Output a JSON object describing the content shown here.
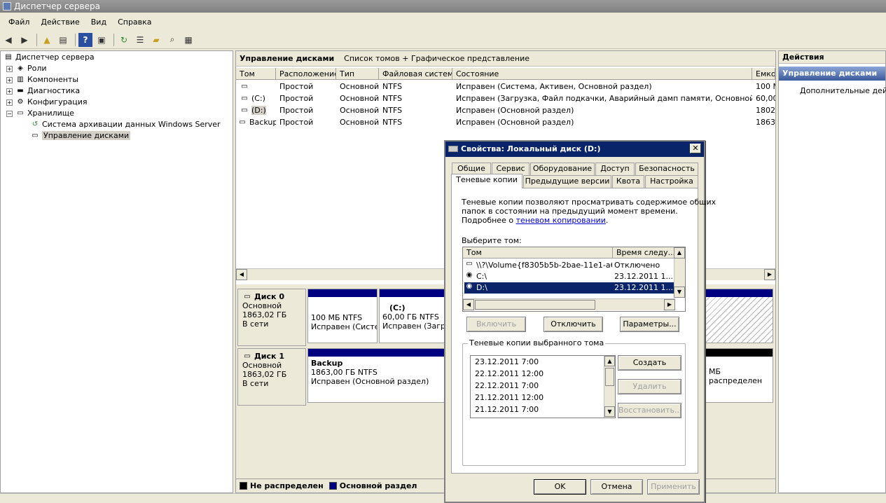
{
  "window": {
    "title": "Диспетчер сервера"
  },
  "menu": [
    "Файл",
    "Действие",
    "Вид",
    "Справка"
  ],
  "tree": {
    "root": "Диспетчер сервера",
    "items": [
      "Роли",
      "Компоненты",
      "Диагностика",
      "Конфигурация",
      "Хранилище"
    ],
    "storage_children": [
      "Система архивации данных Windows Server",
      "Управление дисками"
    ]
  },
  "center": {
    "title": "Управление дисками",
    "subtitle": "Список томов + Графическое представление",
    "columns": [
      "Том",
      "Расположение",
      "Тип",
      "Файловая система",
      "Состояние",
      "Емкос"
    ],
    "rows": [
      {
        "vol": "",
        "loc": "Простой",
        "type": "Основной",
        "fs": "NTFS",
        "state": "Исправен (Система, Активен, Основной раздел)",
        "cap": "100 М"
      },
      {
        "vol": "(C:)",
        "loc": "Простой",
        "type": "Основной",
        "fs": "NTFS",
        "state": "Исправен (Загрузка, Файл подкачки, Аварийный дамп памяти, Основной раздел)",
        "cap": "60,00"
      },
      {
        "vol": "(D:)",
        "loc": "Простой",
        "type": "Основной",
        "fs": "NTFS",
        "state": "Исправен (Основной раздел)",
        "cap": "1802"
      },
      {
        "vol": "Backup",
        "loc": "Простой",
        "type": "Основной",
        "fs": "NTFS",
        "state": "Исправен (Основной раздел)",
        "cap": "1863"
      }
    ]
  },
  "disks": [
    {
      "name": "Диск 0",
      "kind": "Основной",
      "size": "1863,02 ГБ",
      "status": "В сети",
      "p1_size": "100 МБ NTFS",
      "p1_state": "Исправен (Систе",
      "p2_name": "(C:)",
      "p2_size": "60,00 ГБ NTFS",
      "p2_state": "Исправен (Загруз"
    },
    {
      "name": "Диск 1",
      "kind": "Основной",
      "size": "1863,02 ГБ",
      "status": "В сети",
      "p1_name": "Backup",
      "p1_size": "1863,00 ГБ NTFS",
      "p1_state": "Исправен (Основной раздел)",
      "p2_size": "МБ",
      "p2_state": "распределен"
    }
  ],
  "legend": [
    "Не распределен",
    "Основной раздел"
  ],
  "legend_colors": {
    "unallocated": "#000000",
    "primary": "#000080"
  },
  "actions": {
    "title": "Действия",
    "selected": "Управление дисками",
    "item": "Дополнительные дейст"
  },
  "dialog": {
    "title": "Свойства: Локальный диск (D:)",
    "tabs_row1": [
      "Общие",
      "Сервис",
      "Оборудование",
      "Доступ",
      "Безопасность"
    ],
    "tabs_row2": [
      "Теневые копии",
      "Предыдущие версии",
      "Квота",
      "Настройка"
    ],
    "desc1": "Теневые копии позволяют просматривать содержимое общих",
    "desc2": "папок в состоянии на предыдущий момент времени.",
    "desc3_prefix": "Подробнее о ",
    "desc3_link": "теневом копировании",
    "desc3_suffix": ".",
    "select_label": "Выберите том:",
    "vol_columns": [
      "Том",
      "Время следу..."
    ],
    "vol_rows": [
      {
        "vol": "\\\\?\\Volume{f8305b5b-2bae-11e1-a61...",
        "time": "Отключено"
      },
      {
        "vol": "C:\\",
        "time": "23.12.2011 1..."
      },
      {
        "vol": "D:\\",
        "time": "23.12.2011 1..."
      }
    ],
    "btn_enable": "Включить",
    "btn_disable": "Отключить",
    "btn_params": "Параметры...",
    "copies_group": "Теневые копии выбранного тома",
    "copies": [
      "23.12.2011 7:00",
      "22.12.2011 12:00",
      "22.12.2011 7:00",
      "21.12.2011 12:00",
      "21.12.2011 7:00"
    ],
    "btn_create": "Создать",
    "btn_delete": "Удалить",
    "btn_restore": "Восстановить...",
    "btn_ok": "OK",
    "btn_cancel": "Отмена",
    "btn_apply": "Применить"
  }
}
